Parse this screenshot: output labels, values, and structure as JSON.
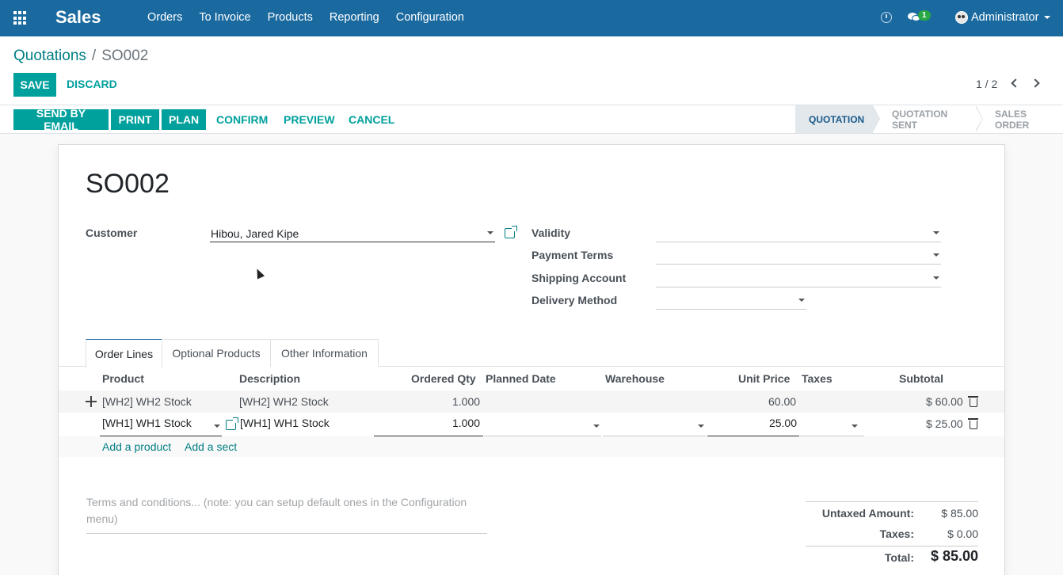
{
  "navbar": {
    "app_name": "Sales",
    "menu": [
      "Orders",
      "To Invoice",
      "Products",
      "Reporting",
      "Configuration"
    ],
    "chat_count": "1",
    "user": "Administrator",
    "bg_color": "#1a6aa0"
  },
  "breadcrumb": {
    "parent": "Quotations",
    "separator": "/",
    "current": "SO002"
  },
  "control": {
    "save_label": "SAVE",
    "discard_label": "DISCARD",
    "pager": "1 / 2"
  },
  "statusbar": {
    "buttons": [
      "SEND BY EMAIL",
      "PRINT",
      "PLAN"
    ],
    "links": [
      "CONFIRM",
      "PREVIEW",
      "CANCEL"
    ],
    "stages": [
      "QUOTATION",
      "QUOTATION SENT",
      "SALES ORDER"
    ],
    "active_stage": "QUOTATION"
  },
  "form": {
    "title": "SO002",
    "customer_label": "Customer",
    "customer_value": "Hibou, Jared Kipe",
    "right_fields": [
      {
        "label": "Validity",
        "value": ""
      },
      {
        "label": "Payment Terms",
        "value": ""
      },
      {
        "label": "Shipping Account",
        "value": ""
      },
      {
        "label": "Delivery Method",
        "value": ""
      }
    ]
  },
  "tabs": [
    "Order Lines",
    "Optional Products",
    "Other Information"
  ],
  "order_lines": {
    "columns": [
      "Product",
      "Description",
      "Ordered Qty",
      "Planned Date",
      "Warehouse",
      "Unit Price",
      "Taxes",
      "Subtotal"
    ],
    "rows": [
      {
        "product": "[WH2] WH2 Stock",
        "description": "[WH2] WH2 Stock",
        "qty": "1.000",
        "unit_price": "60.00",
        "subtotal": "$ 60.00"
      },
      {
        "product": "[WH1] WH1 Stock",
        "description": "[WH1] WH1 Stock",
        "qty": "1.000",
        "unit_price": "25.00",
        "subtotal": "$ 25.00"
      }
    ],
    "add_product": "Add a product",
    "add_section": "Add a sect"
  },
  "terms_placeholder": "Terms and conditions... (note: you can setup default ones in the Configuration menu)",
  "totals": {
    "untaxed_label": "Untaxed Amount:",
    "untaxed_value": "$ 85.00",
    "taxes_label": "Taxes:",
    "taxes_value": "$ 0.00",
    "total_label": "Total:",
    "total_value": "$ 85.00"
  },
  "accent_color": "#00A09D"
}
